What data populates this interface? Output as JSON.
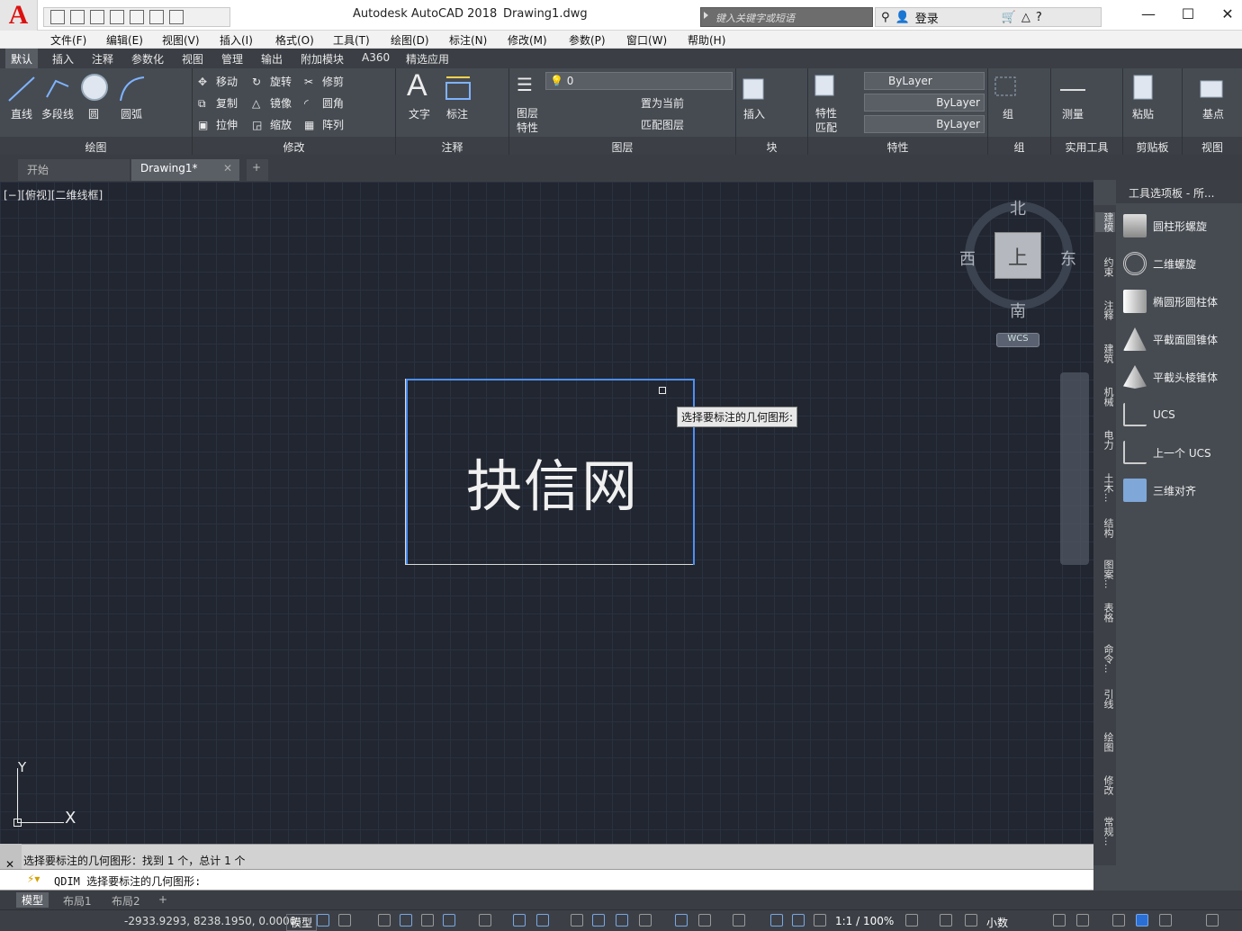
{
  "titlebar": {
    "app_title": "Autodesk AutoCAD 2018",
    "file_title": "Drawing1.dwg",
    "search_placeholder": "键入关键字或短语",
    "login_label": "登录"
  },
  "menubar": {
    "items": [
      "文件(F)",
      "编辑(E)",
      "视图(V)",
      "插入(I)",
      "格式(O)",
      "工具(T)",
      "绘图(D)",
      "标注(N)",
      "修改(M)",
      "参数(P)",
      "窗口(W)",
      "帮助(H)"
    ]
  },
  "ribbon_tabs": {
    "items": [
      "默认",
      "插入",
      "注释",
      "参数化",
      "视图",
      "管理",
      "输出",
      "附加模块",
      "A360",
      "精选应用"
    ],
    "active": "默认"
  },
  "ribbon": {
    "draw": {
      "title": "绘图",
      "line": "直线",
      "polyline": "多段线",
      "circle": "圆",
      "arc": "圆弧"
    },
    "modify": {
      "title": "修改",
      "move": "移动",
      "rotate": "旋转",
      "trim": "修剪",
      "copy": "复制",
      "mirror": "镜像",
      "fillet": "圆角",
      "stretch": "拉伸",
      "scale": "缩放",
      "array": "阵列"
    },
    "annotation": {
      "title": "注释",
      "text": "文字",
      "dimension": "标注"
    },
    "layers": {
      "title": "图层",
      "layer_props": "图层特性",
      "layer_value": "0",
      "set_current": "置为当前",
      "match_layer": "匹配图层"
    },
    "block": {
      "title": "块",
      "insert": "插入"
    },
    "properties": {
      "title": "特性",
      "match": "特性匹配",
      "color": "ByLayer",
      "linetype": "ByLayer",
      "lineweight": "ByLayer"
    },
    "groups": {
      "title": "组",
      "group": "组"
    },
    "utilities": {
      "title": "实用工具",
      "measure": "测量"
    },
    "clipboard": {
      "title": "剪贴板",
      "paste": "粘贴"
    },
    "view": {
      "title": "视图",
      "base": "基点"
    }
  },
  "file_tabs": {
    "start": "开始",
    "drawing": "Drawing1*"
  },
  "drawing": {
    "viewport_label": "[−][俯视][二维线框]",
    "text_content": "抉信网",
    "tooltip": "选择要标注的几何图形:",
    "viewcube": {
      "north": "北",
      "south": "南",
      "east": "东",
      "west": "西",
      "face": "上",
      "wcs": "WCS"
    },
    "ucs": {
      "x": "X",
      "y": "Y"
    }
  },
  "tool_palette": {
    "title": "工具选项板 - 所...",
    "vertical_tabs": [
      "建模",
      "约束",
      "注释",
      "建筑",
      "机械",
      "电力",
      "土木...",
      "结构",
      "图案...",
      "表格",
      "命令...",
      "引线",
      "绘图",
      "修改",
      "常规..."
    ],
    "items": [
      "圆柱形螺旋",
      "二维螺旋",
      "椭圆形圆柱体",
      "平截面圆锥体",
      "平截头棱锥体",
      "UCS",
      "上一个 UCS",
      "三维对齐"
    ]
  },
  "command": {
    "history": "选择要标注的几何图形：找到 1 个，总计 1 个",
    "input": "QDIM 选择要标注的几何图形:"
  },
  "layout_tabs": {
    "model": "模型",
    "layout1": "布局1",
    "layout2": "布局2"
  },
  "statusbar": {
    "coords": "-2933.9293, 8238.1950, 0.0000",
    "model": "模型",
    "scale": "1:1 / 100%",
    "units": "小数"
  },
  "colors": {
    "accent_blue": "#4d8ff2",
    "canvas": "#212630",
    "ribbon": "#464b52"
  }
}
